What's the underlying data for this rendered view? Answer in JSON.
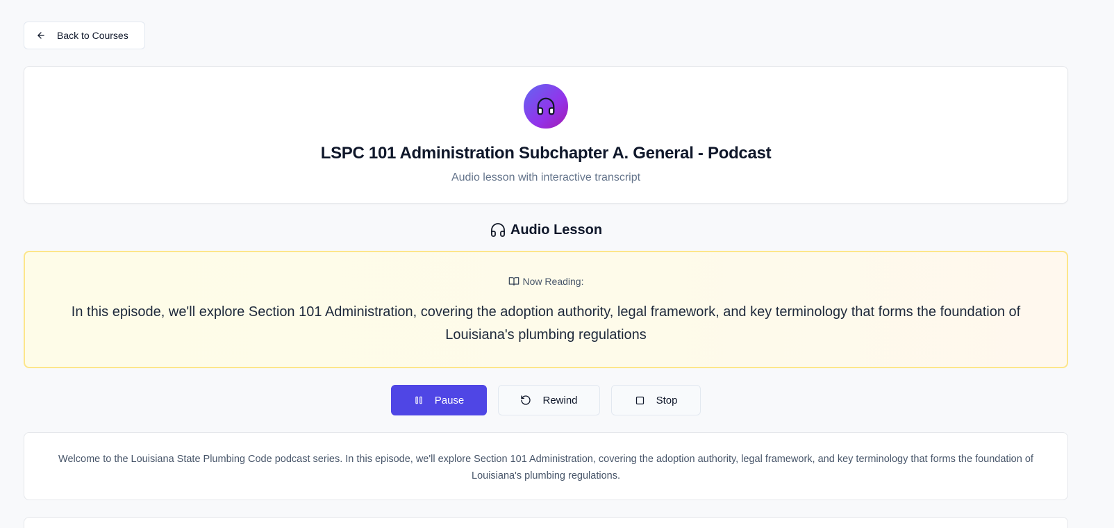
{
  "nav": {
    "back_label": "Back to Courses"
  },
  "header": {
    "icon": "headphones-icon",
    "title": "LSPC 101 Administration Subchapter A. General - Podcast",
    "subtitle": "Audio lesson with interactive transcript"
  },
  "section": {
    "title": "Audio Lesson",
    "icon": "headphones-icon"
  },
  "now_reading": {
    "label": "Now Reading:",
    "icon": "book-icon",
    "text": "In this episode, we'll explore Section 101 Administration, covering the adoption authority, legal framework, and key terminology that forms the foundation of Louisiana's plumbing regulations"
  },
  "controls": {
    "pause_label": "Pause",
    "rewind_label": "Rewind",
    "stop_label": "Stop"
  },
  "transcript": {
    "paragraphs": [
      "Welcome to the Louisiana State Plumbing Code podcast series. In this episode, we'll explore Section 101 Administration, covering the adoption authority, legal framework, and key terminology that forms the foundation of Louisiana's plumbing regulations."
    ]
  },
  "colors": {
    "accent": "#4f46e5",
    "avatar_gradient_start": "#6366f1",
    "avatar_gradient_end": "#a21caf",
    "reading_border": "#fde68a",
    "background": "#f8f9fb"
  }
}
